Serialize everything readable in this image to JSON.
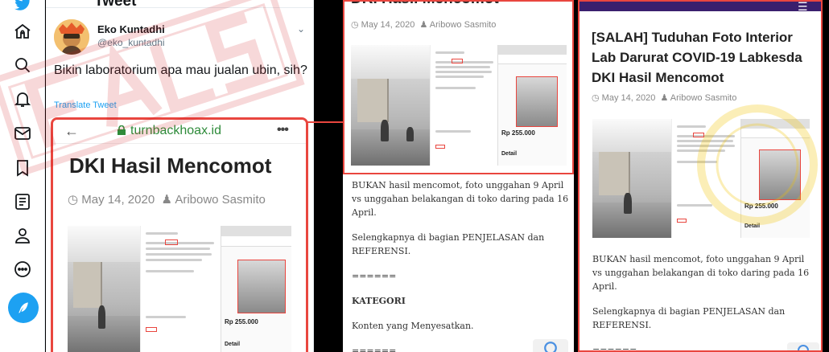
{
  "twitter": {
    "header_title": "Tweet",
    "author_name": "Eko Kuntadhi",
    "author_handle": "@eko_kuntadhi",
    "tweet_text": "Bikin laboratorium apa mau jualan ubin, sih?",
    "translate_label": "Translate Tweet",
    "nav_icons": [
      "home-icon",
      "explore-icon",
      "notifications-icon",
      "messages-icon",
      "bookmarks-icon",
      "lists-icon",
      "profile-icon",
      "more-icon"
    ],
    "accent_color": "#1da1f2"
  },
  "card": {
    "url": "turnbackhoax.id",
    "title": "DKI Hasil Mencomot",
    "date": "May 14, 2020",
    "author": "Aribowo Sasmito",
    "price": "Rp 255.000",
    "detail_label": "Detail"
  },
  "middle": {
    "title": "DKI Hasil Mencomot",
    "date": "May 14, 2020",
    "author": "Aribowo Sasmito",
    "price": "Rp 255.000",
    "detail_label": "Detail",
    "body": [
      "BUKAN hasil mencomot, foto unggahan 9 April vs unggahan belakangan di toko daring pada 16 April.",
      "Selengkapnya di bagian PENJELASAN dan REFERENSI.",
      "======",
      "KATEGORI",
      "Konten yang Menyesatkan.",
      "======"
    ]
  },
  "right": {
    "title": "[SALAH] Tuduhan Foto Interior Lab Darurat COVID-19 Labkesda DKI Hasil Mencomot",
    "date": "May 14, 2020",
    "author": "Aribowo Sasmito",
    "price": "Rp 255.000",
    "detail_label": "Detail",
    "body": [
      "BUKAN hasil mencomot, foto unggahan 9 April vs unggahan belakangan di toko daring pada 16 April.",
      "Selengkapnya di bagian PENJELASAN dan REFERENSI.",
      "======"
    ]
  },
  "colors": {
    "highlight_red": "#e9463f",
    "site_header_purple": "#3a1f6d",
    "url_green": "#2e8b3a"
  }
}
